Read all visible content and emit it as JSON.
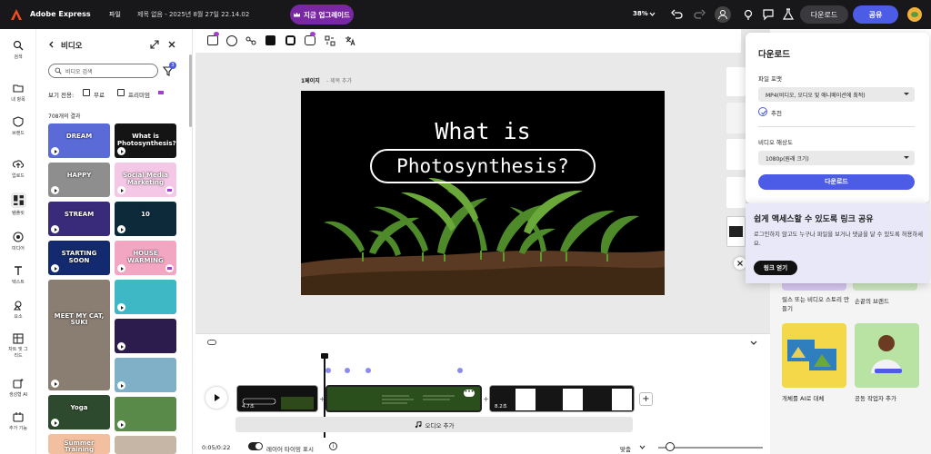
{
  "topbar": {
    "app_name": "Adobe Express",
    "file_label": "파일",
    "doc_title": "제목 없음 - 2025년 8월 27일 22.14.02",
    "upgrade_label": "지금 업그레이드",
    "zoom": "38%",
    "download_label": "다운로드",
    "share_label": "공유"
  },
  "rail": [
    {
      "label": "검색",
      "icon": "search-icon"
    },
    {
      "label": "내 항목",
      "icon": "folder-icon"
    },
    {
      "label": "브랜드",
      "icon": "brand-icon"
    },
    {
      "label": "업로드",
      "icon": "upload-icon"
    },
    {
      "label": "템플릿",
      "icon": "templates-icon"
    },
    {
      "label": "미디어",
      "icon": "media-icon"
    },
    {
      "label": "텍스트",
      "icon": "text-icon"
    },
    {
      "label": "요소",
      "icon": "elements-icon"
    },
    {
      "label": "차트 및 그리드",
      "icon": "chart-icon"
    },
    {
      "label": "생성형 AI",
      "icon": "ai-icon"
    },
    {
      "label": "추가 기능",
      "icon": "addons-icon"
    }
  ],
  "panel": {
    "title": "비디오",
    "search_placeholder": "비디오 검색",
    "filter_badge": "3",
    "view_label": "보기 전용:",
    "free_label": "무료",
    "premium_label": "프리미엄",
    "results": "708개의 결과",
    "thumbs": [
      {
        "text": "DREAM",
        "color": "#5a6bd8"
      },
      {
        "text": "What is Photosynthesis?",
        "color": "#141414"
      },
      {
        "text": "HAPPY",
        "color": "#8e8e8e"
      },
      {
        "text": "Social Media Marketing",
        "color": "#f5c7e6"
      },
      {
        "text": "STREAM",
        "color": "#3a2b7a"
      },
      {
        "text": "10",
        "color": "#0c2a3a"
      },
      {
        "text": "STARTING SOON",
        "color": "#142a6e"
      },
      {
        "text": "HOUSE WARMING",
        "color": "#f2a6c2"
      },
      {
        "text": "MEET MY CAT, SUKI",
        "color": "#8a7d72"
      },
      {
        "text": "",
        "color": "#3fb8c6"
      },
      {
        "text": "",
        "color": "#2c1c4e"
      },
      {
        "text": "",
        "color": "#7fb0c8"
      },
      {
        "text": "Yoga",
        "color": "#2e4a2e"
      },
      {
        "text": "",
        "color": "#5a8a4a"
      },
      {
        "text": "Summer Training",
        "color": "#f2c0a0"
      },
      {
        "text": "",
        "color": "#c6b6a6"
      }
    ]
  },
  "canvas": {
    "page_label": "1페이지",
    "page_sub": " - 제목 추가",
    "headline1": "What is",
    "headline2": "Photosynthesis?"
  },
  "timeline": {
    "clip1_time": "4.7초",
    "clip3_time": "8.2초",
    "audio_label": "오디오 추가",
    "time": "0:05/0:22",
    "toggle_label": "레이어 타이밍 표시",
    "fit_label": "맞춤"
  },
  "templates": {
    "t1": "릴스 또는 비디오 스토리 만들기",
    "t2": "손끝의 브랜드",
    "t3": "개체를 AI로 대체",
    "t4": "공동 작업자 추가"
  },
  "download": {
    "title": "다운로드",
    "format_label": "파일 포맷",
    "format_value": "MP4(비디오, 오디오 및 애니메이션에 최적)",
    "recommended": "추천",
    "res_label": "비디오 해상도",
    "res_value": "1080p(원래 크기)",
    "button": "다운로드"
  },
  "share": {
    "title": "쉽게 액세스할 수 있도록 링크 공유",
    "body": "로그인하지 않고도 누구나 파일을 보거나 댓글을 달 수 있도록 허용하세요.",
    "button": "링크 얻기"
  },
  "colors": {
    "accent": "#4d5ce6",
    "upgrade": "#7a27a3",
    "topbar": "#18181a"
  }
}
